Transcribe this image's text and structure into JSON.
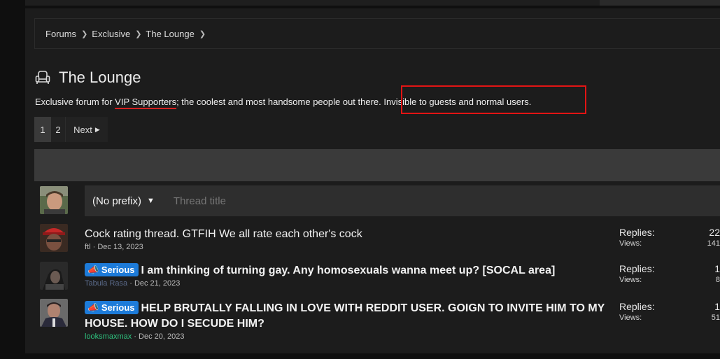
{
  "breadcrumb": [
    "Forums",
    "Exclusive",
    "The Lounge"
  ],
  "forum": {
    "icon": "armchair-icon",
    "title": "The Lounge",
    "desc_pre": "Exclusive forum for ",
    "desc_link": "VIP Supporters",
    "desc_mid": "; the coolest and most handsome people out there",
    "desc_highlight": ". Invisible to guests and normal users."
  },
  "pagination": {
    "pages": [
      "1",
      "2"
    ],
    "next": "Next"
  },
  "new_thread": {
    "prefix": "(No prefix)",
    "placeholder": "Thread title"
  },
  "threads": [
    {
      "title": "Cock rating thread. GTFIH We all rate each other's cock",
      "user": "ftl",
      "date": "Dec 13, 2023",
      "replies_label": "Replies:",
      "replies": "22",
      "views_label": "Views:",
      "views": "141"
    },
    {
      "badge": "Serious",
      "title": "I am thinking of turning gay. Any homosexuals wanna meet up? [SOCAL area]",
      "user": "Tabula Rasa",
      "date": "Dec 21, 2023",
      "replies_label": "Replies:",
      "replies": "1",
      "views_label": "Views:",
      "views": "8"
    },
    {
      "badge": "Serious",
      "title": "HELP BRUTALLY FALLING IN LOVE WITH REDDIT USER. GOIGN TO INVITE HIM TO MY HOUSE. HOW DO I SECUDE HIM?",
      "user": "looksmaxmax",
      "date": "Dec 20, 2023",
      "replies_label": "Replies:",
      "replies": "1",
      "views_label": "Views:",
      "views": "51"
    }
  ],
  "colors": {
    "badge": "#1d7bd9",
    "annotation": "#e31414",
    "username_green": "#2ec27e"
  }
}
